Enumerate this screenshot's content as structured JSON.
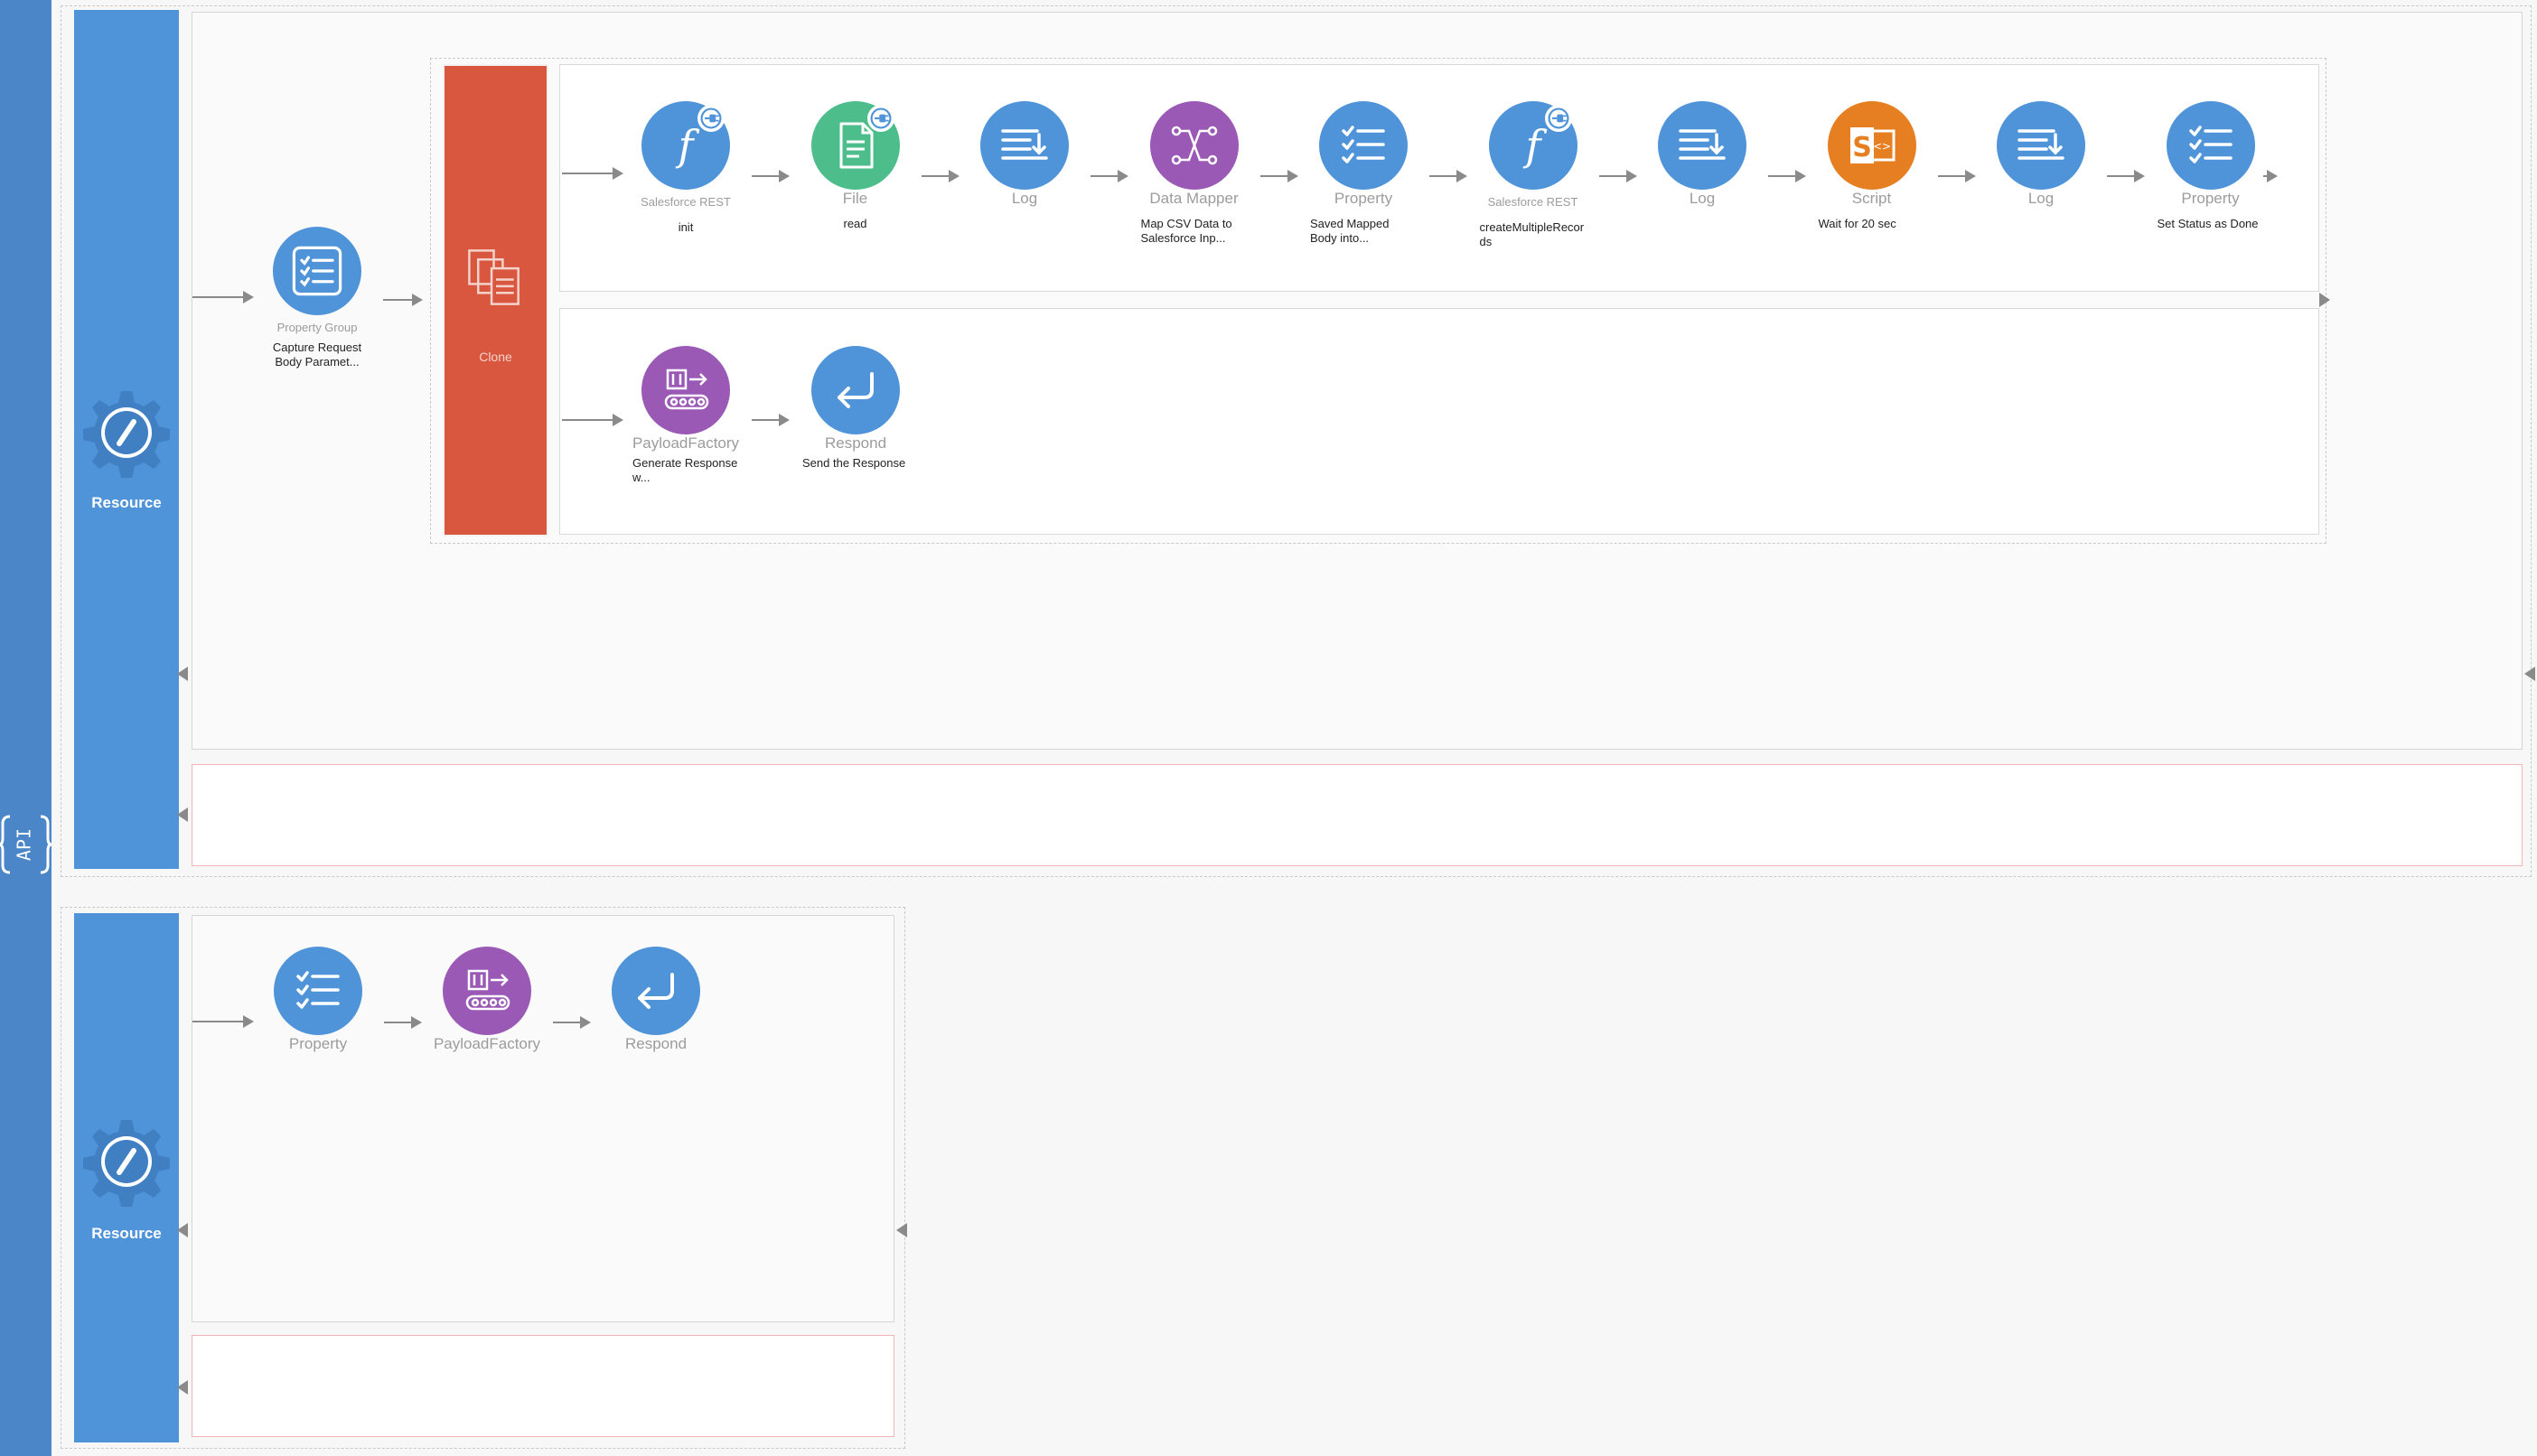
{
  "api": {
    "logo_text": "API",
    "colors": {
      "bar": "#4a86c8",
      "resource": "#4f93d8",
      "clone": "#d9573f"
    }
  },
  "resource_1": {
    "label": "Resource",
    "in_sequence": {
      "property_group": {
        "type": "Property Group",
        "name": "Capture Request Body Paramet...",
        "icon": "checklist-icon"
      },
      "clone": {
        "label": "Clone",
        "branch_1": [
          {
            "type": "Salesforce REST",
            "name": "init",
            "icon": "function-icon",
            "badge": "connector-plug-icon",
            "color": "blue"
          },
          {
            "type": "File",
            "name": "read",
            "icon": "file-icon",
            "badge": "connector-plug-icon",
            "color": "green"
          },
          {
            "type": "Log",
            "name": "",
            "icon": "log-icon",
            "color": "blue"
          },
          {
            "type": "Data Mapper",
            "name": "Map CSV Data to Salesforce Inp...",
            "icon": "mapper-icon",
            "color": "purple"
          },
          {
            "type": "Property",
            "name": "Saved Mapped Body into...",
            "icon": "checklist-icon",
            "color": "blue"
          },
          {
            "type": "Salesforce REST",
            "name": "createMultipleRecords",
            "icon": "function-icon",
            "badge": "connector-plug-icon",
            "color": "blue"
          },
          {
            "type": "Log",
            "name": "",
            "icon": "log-icon",
            "color": "blue"
          },
          {
            "type": "Script",
            "name": "Wait for 20 sec",
            "icon": "script-icon",
            "color": "orange"
          },
          {
            "type": "Log",
            "name": "",
            "icon": "log-icon",
            "color": "blue"
          },
          {
            "type": "Property",
            "name": "Set Status as Done",
            "icon": "checklist-icon",
            "color": "blue"
          }
        ],
        "branch_2": [
          {
            "type": "PayloadFactory",
            "name": "Generate Response w...",
            "icon": "payload-factory-icon",
            "color": "purple"
          },
          {
            "type": "Respond",
            "name": "Send the Response",
            "icon": "respond-icon",
            "color": "blue"
          }
        ]
      }
    }
  },
  "resource_2": {
    "label": "Resource",
    "in_sequence": [
      {
        "type": "Property",
        "name": "",
        "icon": "checklist-icon",
        "color": "blue"
      },
      {
        "type": "PayloadFactory",
        "name": "",
        "icon": "payload-factory-icon",
        "color": "purple"
      },
      {
        "type": "Respond",
        "name": "",
        "icon": "respond-icon",
        "color": "blue"
      }
    ]
  }
}
